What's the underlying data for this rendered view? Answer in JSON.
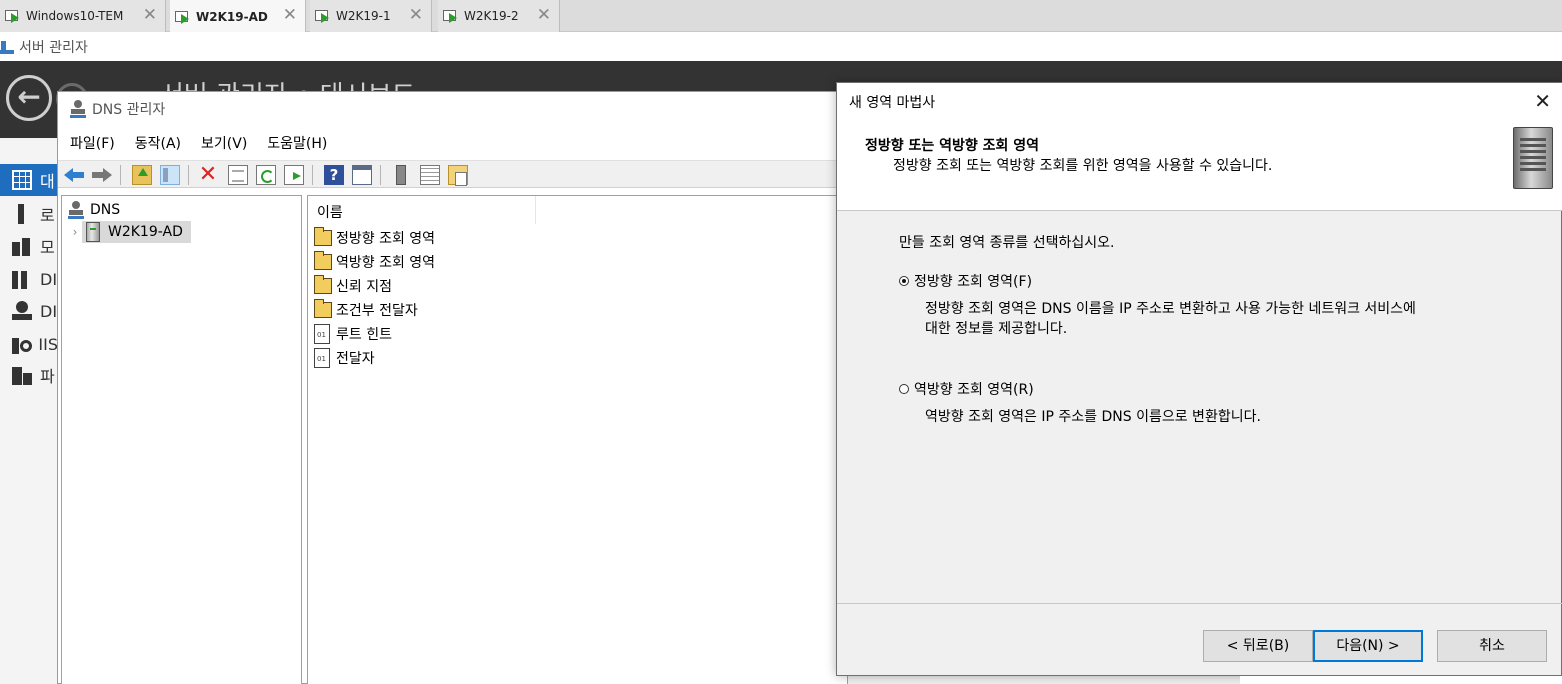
{
  "vm_tabs": [
    {
      "label": "Windows10-TEM",
      "active": false
    },
    {
      "label": "W2K19-AD",
      "active": true
    },
    {
      "label": "W2K19-1",
      "active": false
    },
    {
      "label": "W2K19-2",
      "active": false
    }
  ],
  "server_manager": {
    "window_title": "서버 관리자",
    "header_title": "서버 관리자 • 대시보드",
    "sidebar": [
      {
        "label": "대",
        "icon": "dashboard-grid-icon"
      },
      {
        "label": "로",
        "icon": "local-server-icon"
      },
      {
        "label": "모",
        "icon": "all-servers-icon"
      },
      {
        "label": "DI",
        "icon": "ad-ds-icon"
      },
      {
        "label": "DI",
        "icon": "dns-icon"
      },
      {
        "label": "IIS",
        "icon": "iis-icon"
      },
      {
        "label": "파",
        "icon": "file-services-icon"
      }
    ]
  },
  "dns_manager": {
    "window_title": "DNS 관리자",
    "menu": [
      "파일(F)",
      "동작(A)",
      "보기(V)",
      "도움말(H)"
    ],
    "tree": {
      "root": "DNS",
      "server": "W2K19-AD"
    },
    "list_header": "이름",
    "list_items": [
      {
        "label": "정방향 조회 영역",
        "icon": "folder-icon"
      },
      {
        "label": "역방향 조회 영역",
        "icon": "folder-icon"
      },
      {
        "label": "신뢰 지점",
        "icon": "folder-icon"
      },
      {
        "label": "조건부 전달자",
        "icon": "folder-icon"
      },
      {
        "label": "루트 힌트",
        "icon": "document-icon"
      },
      {
        "label": "전달자",
        "icon": "document-icon"
      }
    ]
  },
  "wizard": {
    "title": "새 영역 마법사",
    "close": "✕",
    "header_title": "정방향 또는 역방향 조회 영역",
    "header_subtitle": "정방향 조회 또는 역방향 조회를 위한 영역을 사용할 수 있습니다.",
    "instruction": "만들 조회 영역 종류를 선택하십시오.",
    "options": [
      {
        "label": "정방향 조회 영역(F)",
        "selected": true,
        "description_1": "정방향 조회 영역은 DNS 이름을 IP 주소로 변환하고 사용 가능한 네트워크 서비스에",
        "description_2": "대한 정보를 제공합니다."
      },
      {
        "label": "역방향 조회 영역(R)",
        "selected": false,
        "description_1": "역방향 조회 영역은 IP 주소를 DNS 이름으로 변환합니다."
      }
    ],
    "buttons": {
      "back": "< 뒤로(B)",
      "next": "다음(N) >",
      "cancel": "취소"
    }
  },
  "colors": {
    "header_bg": "#333333",
    "selection_blue": "#1f6dbf",
    "default_button_border": "#0078d7"
  }
}
